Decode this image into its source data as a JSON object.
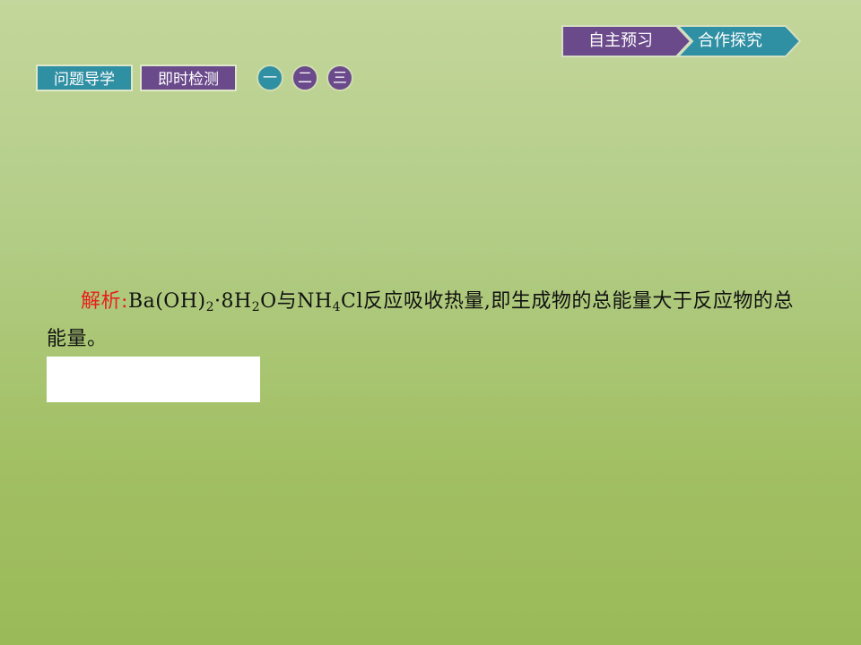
{
  "nav": {
    "preview": "自主预习",
    "explore": "合作探究"
  },
  "tabs": {
    "guide": "问题导学",
    "check": "即时检测"
  },
  "sections": {
    "one": "一",
    "two": "二",
    "three": "三"
  },
  "analysis": {
    "label": "解析",
    "colon": ":",
    "ba": "Ba(OH)",
    "ba_sub": "2",
    "dot": "·8H",
    "h_sub": "2",
    "o_and": "O与NH",
    "n_sub": "4",
    "rest": "Cl反应吸收热量,即生成物的总能量大于反应物的总能量。"
  },
  "colors": {
    "teal": "#2f8fa3",
    "purple": "#6a4a8b",
    "label_red": "#e8201a"
  }
}
